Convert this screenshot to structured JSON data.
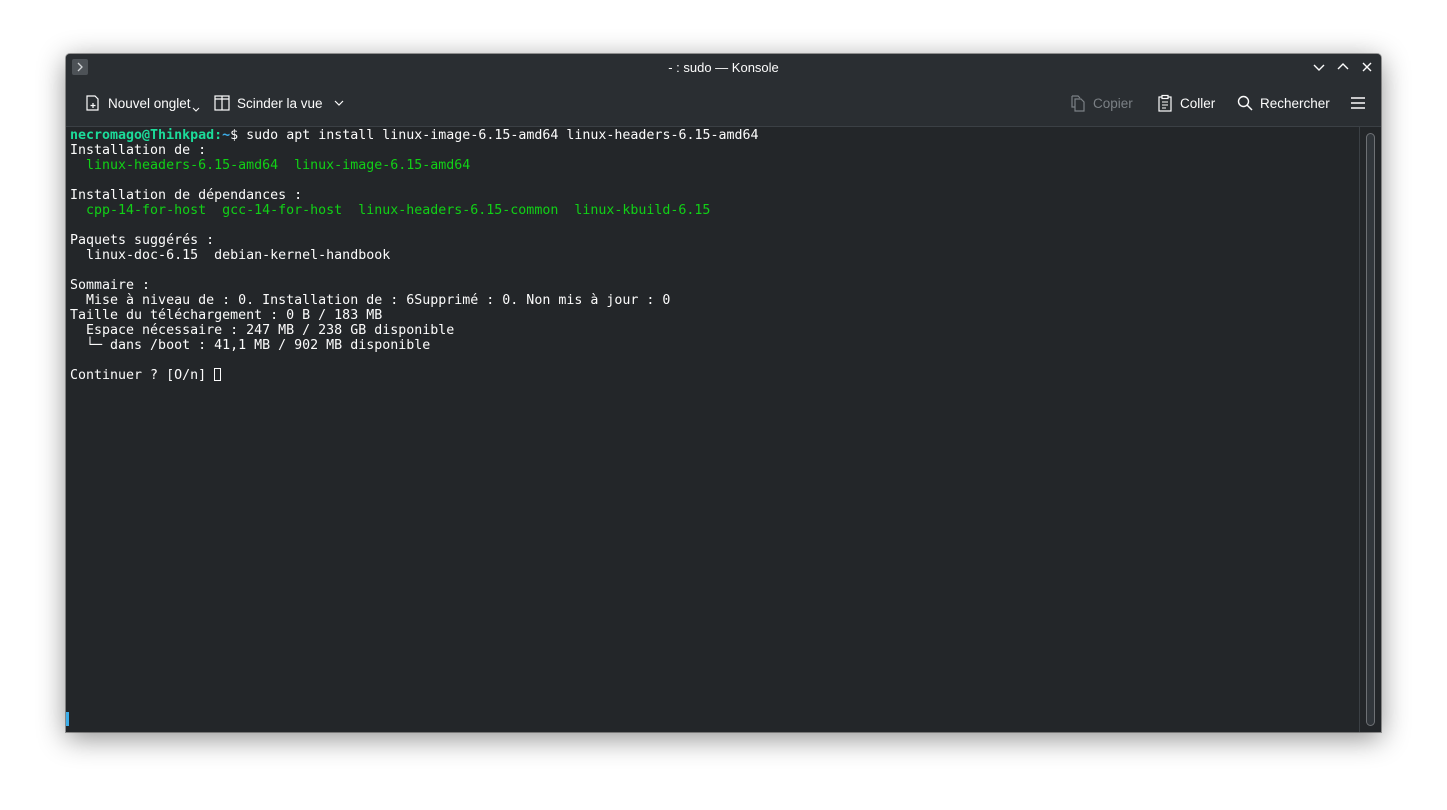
{
  "window": {
    "title": "- : sudo — Konsole"
  },
  "toolbar": {
    "new_tab": "Nouvel onglet",
    "split_view": "Scinder la vue",
    "copy": "Copier",
    "paste": "Coller",
    "search": "Rechercher"
  },
  "terminal": {
    "prompt_user": "necromago@Thinkpad",
    "prompt_sep": ":",
    "prompt_path": "~",
    "prompt_symbol": "$",
    "command": " sudo apt install linux-image-6.15-amd64 linux-headers-6.15-amd64",
    "line_installing": "Installation de :",
    "installing_packages": "  linux-headers-6.15-amd64  linux-image-6.15-amd64",
    "line_dependencies": "Installation de dépendances :",
    "dependency_packages": "  cpp-14-for-host  gcc-14-for-host  linux-headers-6.15-common  linux-kbuild-6.15",
    "line_suggested": "Paquets suggérés :",
    "suggested_packages": "  linux-doc-6.15  debian-kernel-handbook",
    "line_summary": "Sommaire :",
    "summary_counts": "  Mise à niveau de : 0. Installation de : 6Supprimé : 0. Non mis à jour : 0",
    "download_size": "Taille du téléchargement : 0 B / 183 MB",
    "space_needed": "  Espace nécessaire : 247 MB / 238 GB disponible",
    "boot_space": "  └─ dans /boot : 41,1 MB / 902 MB disponible",
    "continue_prompt": "Continuer ? [O/n] "
  },
  "colors": {
    "prompt_user": "#1cdc9a",
    "prompt_path": "#3daee9",
    "package_names": "#11d116",
    "background": "#232629"
  },
  "icons": {
    "app": "konsole-icon",
    "minimize": "chevron-down-icon",
    "maximize": "chevron-up-icon",
    "close": "close-icon",
    "new_tab": "new-tab-icon",
    "split_view": "split-view-icon",
    "copy": "copy-icon",
    "paste": "paste-icon",
    "search": "search-icon",
    "menu": "hamburger-menu-icon"
  }
}
